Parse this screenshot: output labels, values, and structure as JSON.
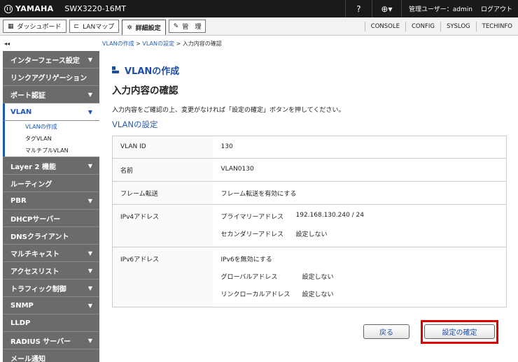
{
  "header": {
    "brand": "YAMAHA",
    "model": "SWX3220-16MT",
    "help_label": "?",
    "user": "管理ユーザー：admin",
    "logout": "ログアウト"
  },
  "nav": {
    "dashboard": "ダッシュボード",
    "lanmap": "LANマップ",
    "advanced": "詳細設定",
    "manage": "管　理",
    "links": [
      "CONSOLE",
      "CONFIG",
      "SYSLOG",
      "TECHINFO"
    ]
  },
  "collapse_label": "◂◂",
  "breadcrumb": {
    "item1": "VLANの作成",
    "sep": " > ",
    "item2": "VLANの設定",
    "current": "入力内容の確認"
  },
  "sidebar": {
    "items": [
      {
        "label": "インターフェース設定",
        "arrow": "▼"
      },
      {
        "label": "リンクアグリゲーション",
        "arrow": ""
      },
      {
        "label": "ポート認証",
        "arrow": "▼"
      },
      {
        "label": "VLAN",
        "arrow": "▼"
      },
      {
        "label": "Layer 2 機能",
        "arrow": "▼"
      },
      {
        "label": "ルーティング",
        "arrow": ""
      },
      {
        "label": "PBR",
        "arrow": "▼"
      },
      {
        "label": "DHCPサーバー",
        "arrow": ""
      },
      {
        "label": "DNSクライアント",
        "arrow": ""
      },
      {
        "label": "マルチキャスト",
        "arrow": "▼"
      },
      {
        "label": "アクセスリスト",
        "arrow": "▼"
      },
      {
        "label": "トラフィック制御",
        "arrow": "▼"
      },
      {
        "label": "SNMP",
        "arrow": "▼"
      },
      {
        "label": "LLDP",
        "arrow": ""
      },
      {
        "label": "RADIUS サーバー",
        "arrow": "▼"
      },
      {
        "label": "メール通知",
        "arrow": ""
      }
    ],
    "vlan_sub": [
      "VLANの作成",
      "タグVLAN",
      "マルチプルVLAN"
    ]
  },
  "main": {
    "section": "VLANの作成",
    "title": "入力内容の確認",
    "description": "入力内容をご確認の上、変更がなければ「設定の確定」ボタンを押してください。",
    "subtitle": "VLANの設定",
    "rows": {
      "vlan_id": {
        "key": "VLAN ID",
        "value": "130"
      },
      "name": {
        "key": "名前",
        "value": "VLAN0130"
      },
      "frame": {
        "key": "フレーム転送",
        "value": "フレーム転送を有効にする"
      },
      "ipv4": {
        "key": "IPv4アドレス",
        "primary_label": "プライマリーアドレス",
        "primary_value": "192.168.130.240 / 24",
        "secondary_label": "セカンダリーアドレス",
        "secondary_value": "設定しない"
      },
      "ipv6": {
        "key": "IPv6アドレス",
        "enable": "IPv6を無効にする",
        "global_label": "グローバルアドレス",
        "global_value": "設定しない",
        "linklocal_label": "リンクローカルアドレス",
        "linklocal_value": "設定しない"
      }
    }
  },
  "buttons": {
    "back": "戻る",
    "confirm": "設定の確定"
  },
  "colors": {
    "accent": "#1f4fa3",
    "highlight": "#e00000",
    "sidebar": "#6b6b6b"
  }
}
